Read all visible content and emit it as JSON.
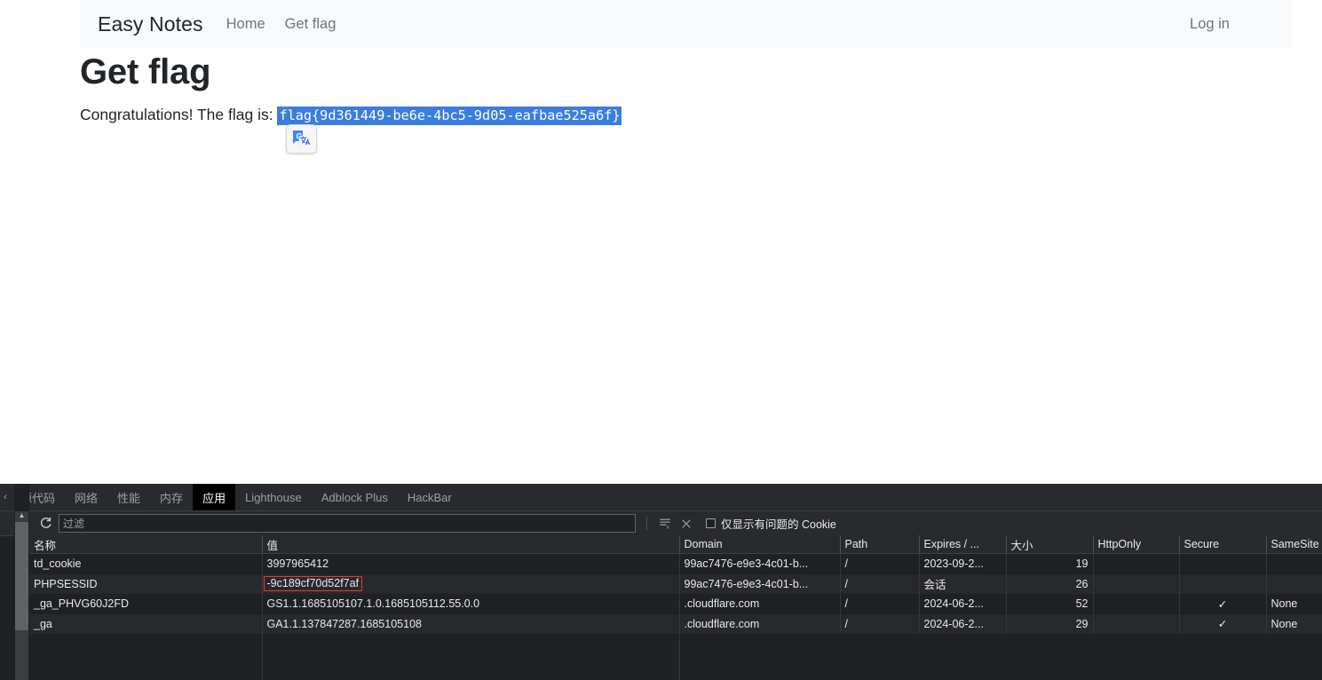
{
  "browser_page": {
    "navbar": {
      "brand": "Easy Notes",
      "links": [
        {
          "label": "Home"
        },
        {
          "label": "Get flag"
        }
      ],
      "right_link": {
        "label": "Log in"
      }
    },
    "heading": "Get flag",
    "flag_prefix": "Congratulations! The flag is:",
    "flag_value": "flag{9d361449-be6e-4bc5-9d05-eafbae525a6f}",
    "translate_icon": "google-translate-icon",
    "colors": {
      "navbar_bg": "#f8f9fa",
      "text": "#212529",
      "muted_link": "#6c757d",
      "selection_bg": "#3b7ddd"
    }
  },
  "devtools": {
    "tabs": [
      {
        "label": "源代码",
        "active": false
      },
      {
        "label": "网络",
        "active": false
      },
      {
        "label": "性能",
        "active": false
      },
      {
        "label": "内存",
        "active": false
      },
      {
        "label": "应用",
        "active": true
      },
      {
        "label": "Lighthouse",
        "active": false
      },
      {
        "label": "Adblock Plus",
        "active": false
      },
      {
        "label": "HackBar",
        "active": false
      }
    ],
    "toolbar": {
      "refresh_icon": "refresh-icon",
      "filter_placeholder": "过滤",
      "filter_value": "",
      "clear_all_icon": "clear-all-cookies-icon",
      "delete_icon": "delete-cookie-icon",
      "checkbox_label": "仅显示有问题的 Cookie",
      "checkbox_checked": false
    },
    "cookie_table": {
      "columns": [
        "名称",
        "值",
        "Domain",
        "Path",
        "Expires / ...",
        "大小",
        "HttpOnly",
        "Secure",
        "SameSite"
      ],
      "rows": [
        {
          "name": "td_cookie",
          "value": "3997965412",
          "value_highlighted": false,
          "domain": "99ac7476-e9e3-4c01-b...",
          "path": "/",
          "expires": "2023-09-2...",
          "size": "19",
          "http_only": "",
          "secure": "",
          "same_site": ""
        },
        {
          "name": "PHPSESSID",
          "value": "-9c189cf70d52f7af",
          "value_highlighted": true,
          "domain": "99ac7476-e9e3-4c01-b...",
          "path": "/",
          "expires": "会话",
          "size": "26",
          "http_only": "",
          "secure": "",
          "same_site": ""
        },
        {
          "name": "_ga_PHVG60J2FD",
          "value": "GS1.1.1685105107.1.0.1685105112.55.0.0",
          "value_highlighted": false,
          "domain": ".cloudflare.com",
          "path": "/",
          "expires": "2024-06-2...",
          "size": "52",
          "http_only": "",
          "secure": "✓",
          "same_site": "None"
        },
        {
          "name": "_ga",
          "value": "GA1.1.137847287.1685105108",
          "value_highlighted": false,
          "domain": ".cloudflare.com",
          "path": "/",
          "expires": "2024-06-2...",
          "size": "29",
          "http_only": "",
          "secure": "✓",
          "same_site": "None"
        }
      ]
    },
    "colors": {
      "panel_bg": "#202124",
      "toolbar_bg": "#292a2d",
      "active_tab_bg": "#000000",
      "text": "#e8eaed",
      "muted": "#9aa0a6",
      "highlight_box": "#e53935"
    }
  }
}
